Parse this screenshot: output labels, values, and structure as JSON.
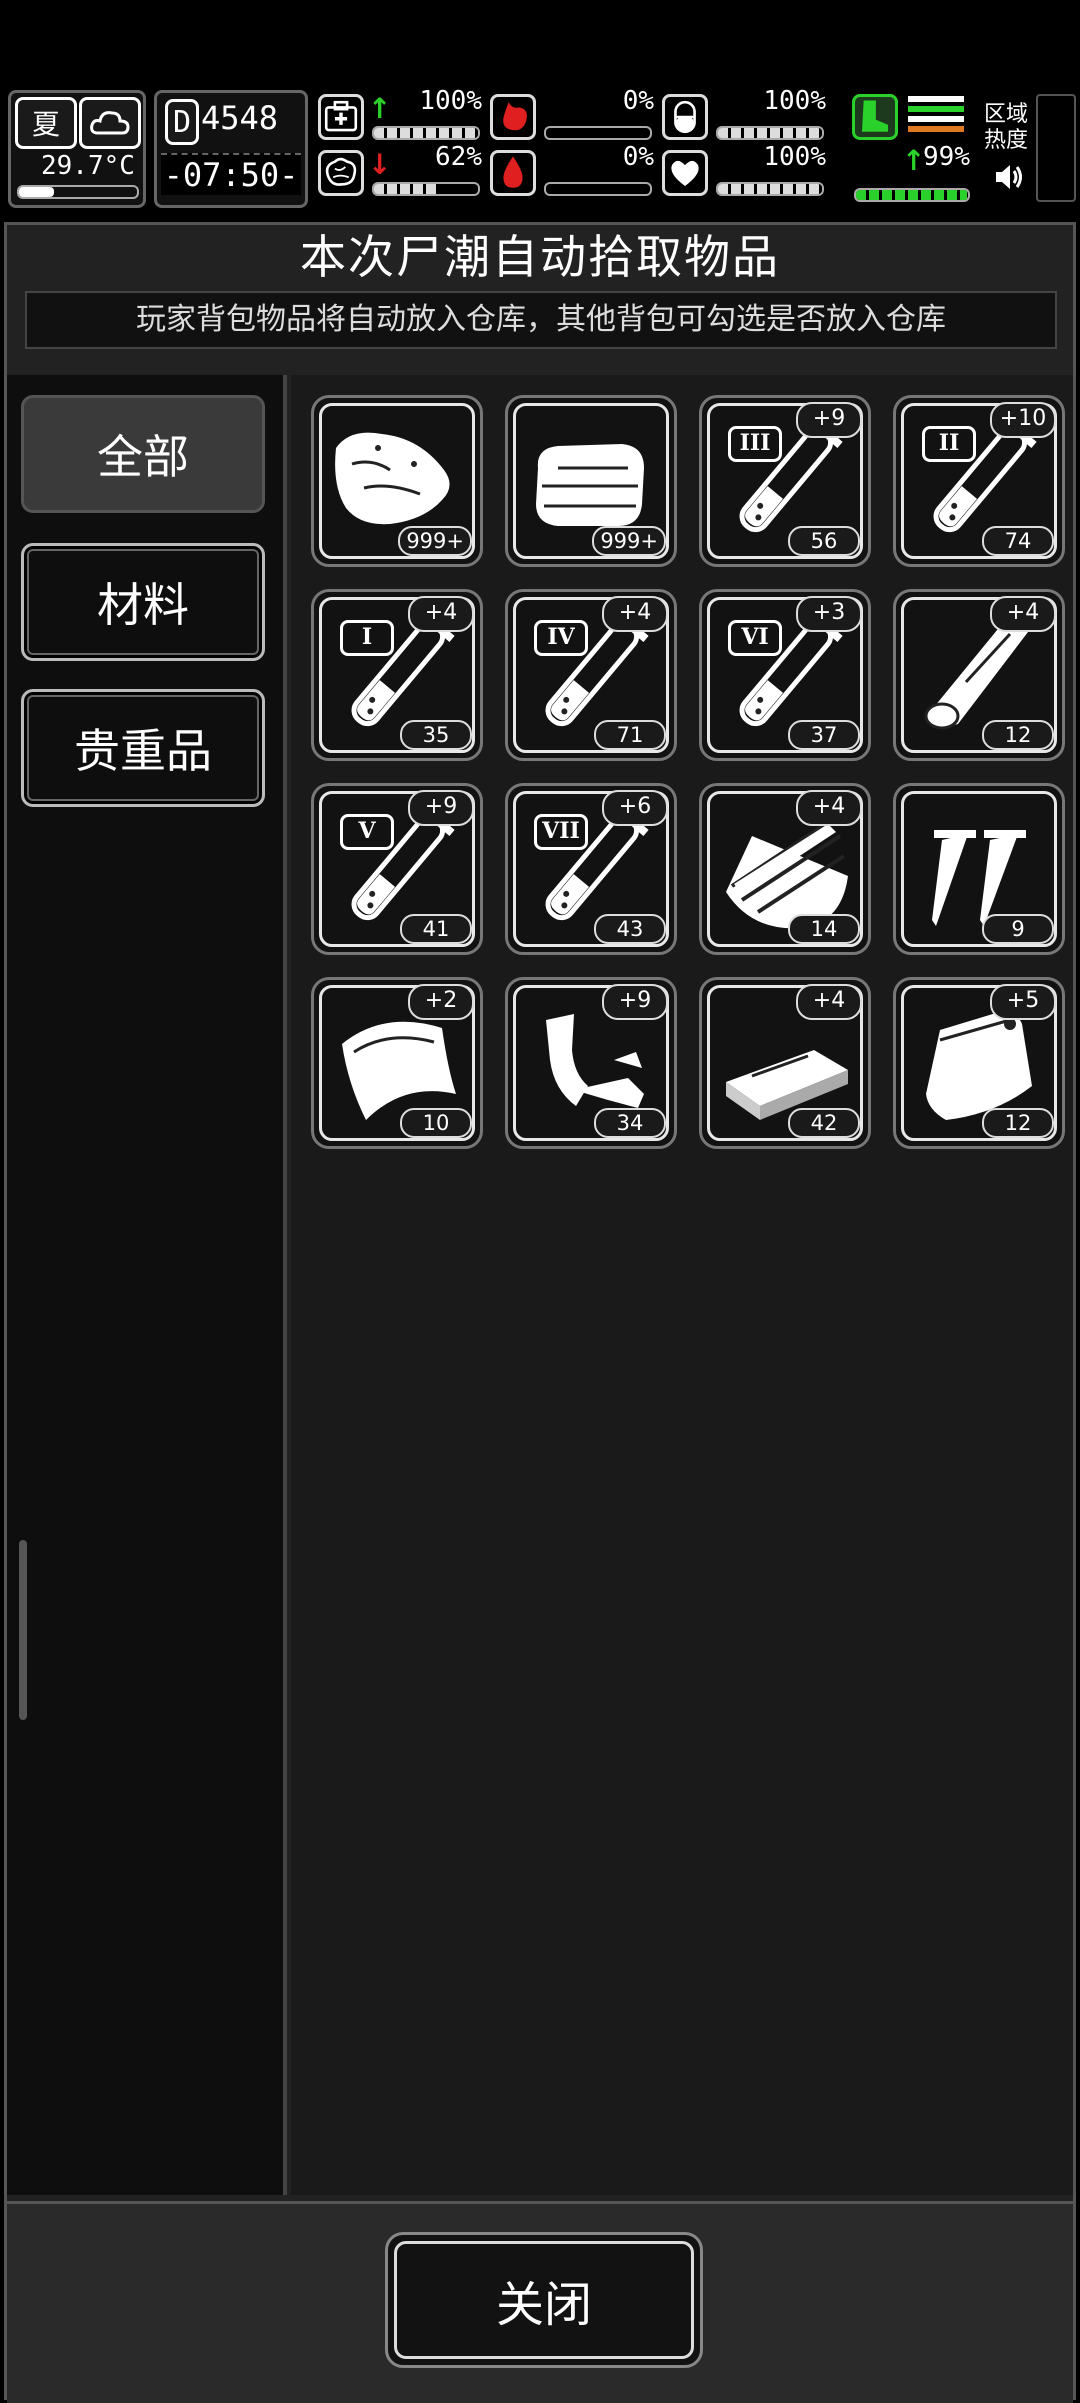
{
  "status": {
    "season": "夏",
    "weather_icon": "cloud-icon",
    "temperature": "29.7°C",
    "day_prefix": "D",
    "day": "4548",
    "time": "-07:50-",
    "region_label_1": "区域",
    "region_label_2": "热度",
    "stats": [
      {
        "name": "health",
        "icon": "medkit-icon",
        "trend": "up",
        "value": "100%",
        "level": 1.0
      },
      {
        "name": "hunger",
        "icon": "stomach-icon",
        "trend": "",
        "value": "0%",
        "level": 0.0
      },
      {
        "name": "stamina",
        "icon": "pill-icon",
        "trend": "",
        "value": "100%",
        "level": 1.0
      },
      {
        "name": "sanity",
        "icon": "brain-icon",
        "trend": "down",
        "value": "62%",
        "level": 0.62
      },
      {
        "name": "bleeding",
        "icon": "blood-drop-icon",
        "trend": "",
        "value": "0%",
        "level": 0.0
      },
      {
        "name": "mood",
        "icon": "heart-icon",
        "trend": "",
        "value": "100%",
        "level": 1.0
      },
      {
        "name": "speed",
        "icon": "boot-icon",
        "trend": "up",
        "value": "99%",
        "level": 0.99
      }
    ]
  },
  "dialog": {
    "title": "本次尸潮自动拾取物品",
    "subtitle": "玩家背包物品将自动放入仓库，其他背包可勾选是否放入仓库",
    "tabs": [
      "全部",
      "材料",
      "贵重品"
    ],
    "active_tab": 0,
    "close_label": "关闭"
  },
  "items": [
    {
      "icon": "raw-meat-icon",
      "count": "999+",
      "bonus": "",
      "roman": ""
    },
    {
      "icon": "cloth-icon",
      "count": "999+",
      "bonus": "",
      "roman": ""
    },
    {
      "icon": "serum-vial-icon",
      "count": "56",
      "bonus": "+9",
      "roman": "III"
    },
    {
      "icon": "serum-vial-icon",
      "count": "74",
      "bonus": "+10",
      "roman": "II"
    },
    {
      "icon": "serum-vial-icon",
      "count": "35",
      "bonus": "+4",
      "roman": "I"
    },
    {
      "icon": "serum-vial-icon",
      "count": "71",
      "bonus": "+4",
      "roman": "IV"
    },
    {
      "icon": "serum-vial-icon",
      "count": "37",
      "bonus": "+3",
      "roman": "VI"
    },
    {
      "icon": "rolled-leather-icon",
      "count": "12",
      "bonus": "+4",
      "roman": ""
    },
    {
      "icon": "serum-vial-icon",
      "count": "41",
      "bonus": "+9",
      "roman": "V"
    },
    {
      "icon": "serum-vial-icon",
      "count": "43",
      "bonus": "+6",
      "roman": "VII"
    },
    {
      "icon": "wood-planks-icon",
      "count": "14",
      "bonus": "+4",
      "roman": ""
    },
    {
      "icon": "nails-icon",
      "count": "9",
      "bonus": "",
      "roman": ""
    },
    {
      "icon": "fabric-scrap-icon",
      "count": "10",
      "bonus": "+2",
      "roman": ""
    },
    {
      "icon": "scrap-parts-icon",
      "count": "34",
      "bonus": "+9",
      "roman": ""
    },
    {
      "icon": "brick-icon",
      "count": "42",
      "bonus": "+4",
      "roman": ""
    },
    {
      "icon": "plastic-bag-icon",
      "count": "12",
      "bonus": "+5",
      "roman": ""
    }
  ]
}
